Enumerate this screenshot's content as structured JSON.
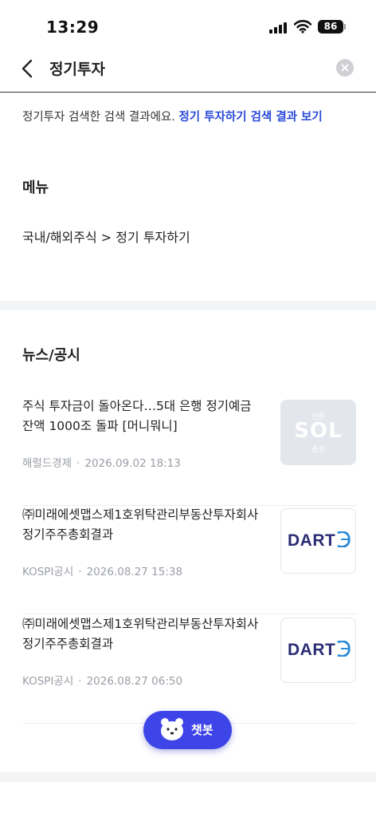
{
  "status_bar": {
    "time": "13:29",
    "battery": "86"
  },
  "search": {
    "query": "정기투자"
  },
  "suggestion": {
    "text": "정기투자 검색한 검색 결과에요.",
    "link": "정기 투자하기 검색 결과 보기"
  },
  "menu": {
    "title": "메뉴",
    "path": "국내/해외주식 > 정기 투자하기"
  },
  "news": {
    "title": "뉴스/공시",
    "items": [
      {
        "headline": "주식 투자금이 돌아온다…5대 은행 정기예금 잔액 1000조 돌파 [머니뭐니]",
        "source": "해럴드경제",
        "separator": "·",
        "date": "2026.09.02 18:13",
        "thumb": {
          "top": "신한",
          "main": "SOL",
          "sub": "증권"
        }
      },
      {
        "headline": "㈜미래에셋맵스제1호위탁관리부동산투자회사 정기주주총회결과",
        "source": "KOSPI공시",
        "separator": "·",
        "date": "2026.08.27 15:38",
        "thumb": {
          "main": "DART"
        }
      },
      {
        "headline": "㈜미래에셋맵스제1호위탁관리부동산투자회사 정기주주총회결과",
        "source": "KOSPI공시",
        "separator": "·",
        "date": "2026.08.27 06:50",
        "thumb": {
          "main": "DART"
        }
      }
    ]
  },
  "chatbot": {
    "label": "챗봇"
  },
  "colors": {
    "accent": "#3d45e8",
    "link": "#2848d8",
    "meta": "#9a9ea6"
  },
  "icons": {
    "back": "chevron-left-icon",
    "clear": "clear-icon",
    "chatbot": "bear-face-icon"
  }
}
